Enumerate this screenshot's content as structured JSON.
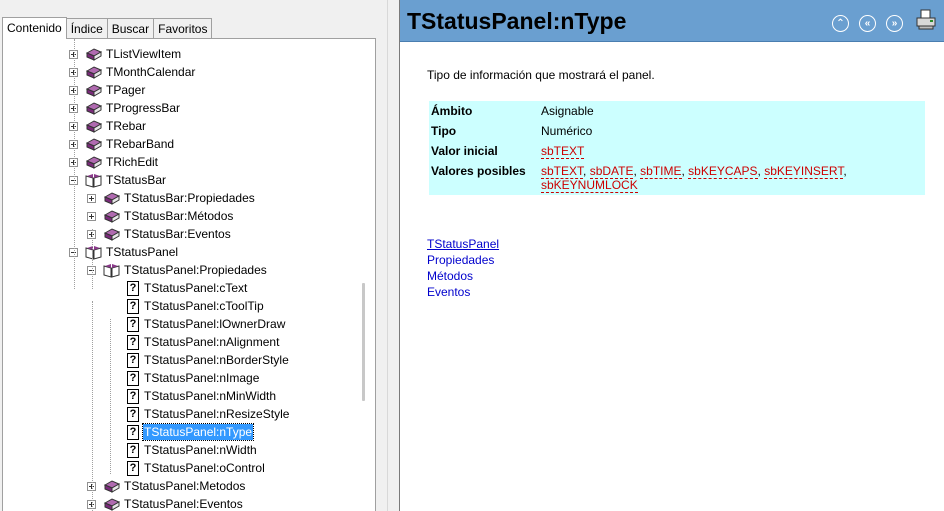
{
  "tabs": [
    "Contenido",
    "Índice",
    "Buscar",
    "Favoritos"
  ],
  "tree": [
    {
      "label": "TListViewItem",
      "level": 0,
      "icon": "book-closed",
      "exp": "plus"
    },
    {
      "label": "TMonthCalendar",
      "level": 0,
      "icon": "book-closed",
      "exp": "plus"
    },
    {
      "label": "TPager",
      "level": 0,
      "icon": "book-closed",
      "exp": "plus"
    },
    {
      "label": "TProgressBar",
      "level": 0,
      "icon": "book-closed",
      "exp": "plus"
    },
    {
      "label": "TRebar",
      "level": 0,
      "icon": "book-closed",
      "exp": "plus"
    },
    {
      "label": "TRebarBand",
      "level": 0,
      "icon": "book-closed",
      "exp": "plus"
    },
    {
      "label": "TRichEdit",
      "level": 0,
      "icon": "book-closed",
      "exp": "plus"
    },
    {
      "label": "TStatusBar",
      "level": 0,
      "icon": "book-open",
      "exp": "minus"
    },
    {
      "label": "TStatusBar:Propiedades",
      "level": 1,
      "icon": "book-closed",
      "exp": "plus"
    },
    {
      "label": "TStatusBar:Métodos",
      "level": 1,
      "icon": "book-closed",
      "exp": "plus"
    },
    {
      "label": "TStatusBar:Eventos",
      "level": 1,
      "icon": "book-closed",
      "exp": "plus"
    },
    {
      "label": "TStatusPanel",
      "level": 0,
      "icon": "book-open",
      "exp": "minus"
    },
    {
      "label": "TStatusPanel:Propiedades",
      "level": 1,
      "icon": "book-open",
      "exp": "minus"
    },
    {
      "label": "TStatusPanel:cText",
      "level": 2,
      "icon": "help"
    },
    {
      "label": "TStatusPanel:cToolTip",
      "level": 2,
      "icon": "help"
    },
    {
      "label": "TStatusPanel:lOwnerDraw",
      "level": 2,
      "icon": "help"
    },
    {
      "label": "TStatusPanel:nAlignment",
      "level": 2,
      "icon": "help"
    },
    {
      "label": "TStatusPanel:nBorderStyle",
      "level": 2,
      "icon": "help"
    },
    {
      "label": "TStatusPanel:nImage",
      "level": 2,
      "icon": "help"
    },
    {
      "label": "TStatusPanel:nMinWidth",
      "level": 2,
      "icon": "help"
    },
    {
      "label": "TStatusPanel:nResizeStyle",
      "level": 2,
      "icon": "help"
    },
    {
      "label": "TStatusPanel:nType",
      "level": 2,
      "icon": "help",
      "selected": true
    },
    {
      "label": "TStatusPanel:nWidth",
      "level": 2,
      "icon": "help"
    },
    {
      "label": "TStatusPanel:oControl",
      "level": 2,
      "icon": "help"
    },
    {
      "label": "TStatusPanel:Metodos",
      "level": 1,
      "icon": "book-closed",
      "exp": "plus"
    },
    {
      "label": "TStatusPanel:Eventos",
      "level": 1,
      "icon": "book-closed",
      "exp": "plus"
    }
  ],
  "page": {
    "title": "TStatusPanel:nType",
    "description": "Tipo de información que mostrará el panel.",
    "props": {
      "ambito_label": "Ámbito",
      "ambito_value": "Asignable",
      "tipo_label": "Tipo",
      "tipo_value": "Numérico",
      "valor_inicial_label": "Valor inicial",
      "valor_inicial_value": "sbTEXT",
      "valores_label": "Valores posibles",
      "valores": [
        "sbTEXT",
        "sbDATE",
        "sbTIME",
        "sbKEYCAPS",
        "sbKEYINSERT",
        "sbKEYNUMLOCK"
      ]
    },
    "links": [
      "TStatusPanel",
      "Propiedades",
      "Métodos",
      "Eventos"
    ]
  },
  "colors": {
    "header_bg": "#6a9fd0",
    "table_bg": "#ccffff",
    "selection": "#3399ff",
    "link": "#0000cc",
    "code": "#cc0000"
  }
}
